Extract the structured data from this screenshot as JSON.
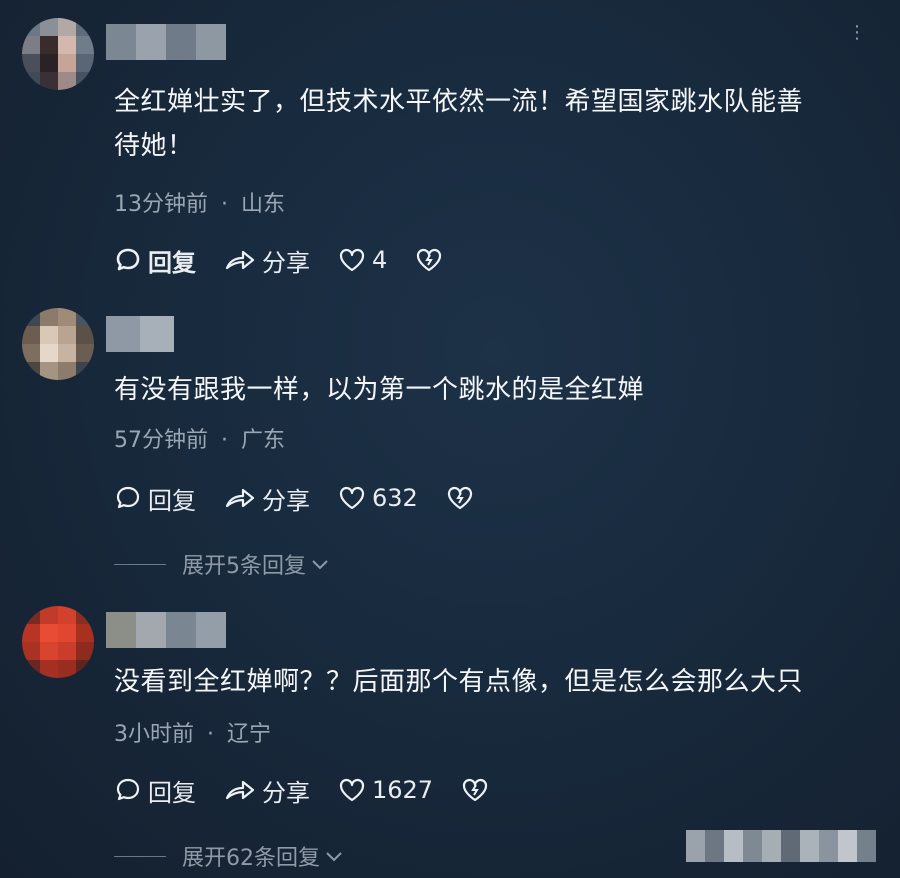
{
  "comments": [
    {
      "text_line1": "全红婵壮实了，但技术水平依然一流！希望国家跳水队能善",
      "text_line2": "待她！",
      "time": "13分钟前",
      "location": "山东",
      "reply_label": "回复",
      "share_label": "分享",
      "likes": "4"
    },
    {
      "text_line1": "有没有跟我一样，以为第一个跳水的是全红婵",
      "time": "57分钟前",
      "location": "广东",
      "reply_label": "回复",
      "share_label": "分享",
      "likes": "632",
      "expand_label": "展开5条回复"
    },
    {
      "text_line1": "没看到全红婵啊？？后面那个有点像，但是怎么会那么大只",
      "time": "3小时前",
      "location": "辽宁",
      "reply_label": "回复",
      "share_label": "分享",
      "likes": "1627",
      "expand_label": "展开62条回复"
    }
  ],
  "meta_separator": "·",
  "icons": [
    "comment-bubble-icon",
    "share-arrow-icon",
    "heart-icon",
    "broken-heart-icon",
    "chevron-down-icon",
    "more-icon"
  ],
  "colors": {
    "background": "#182a3d",
    "text": "#f4f6f8",
    "meta": "#9aa6b3"
  }
}
